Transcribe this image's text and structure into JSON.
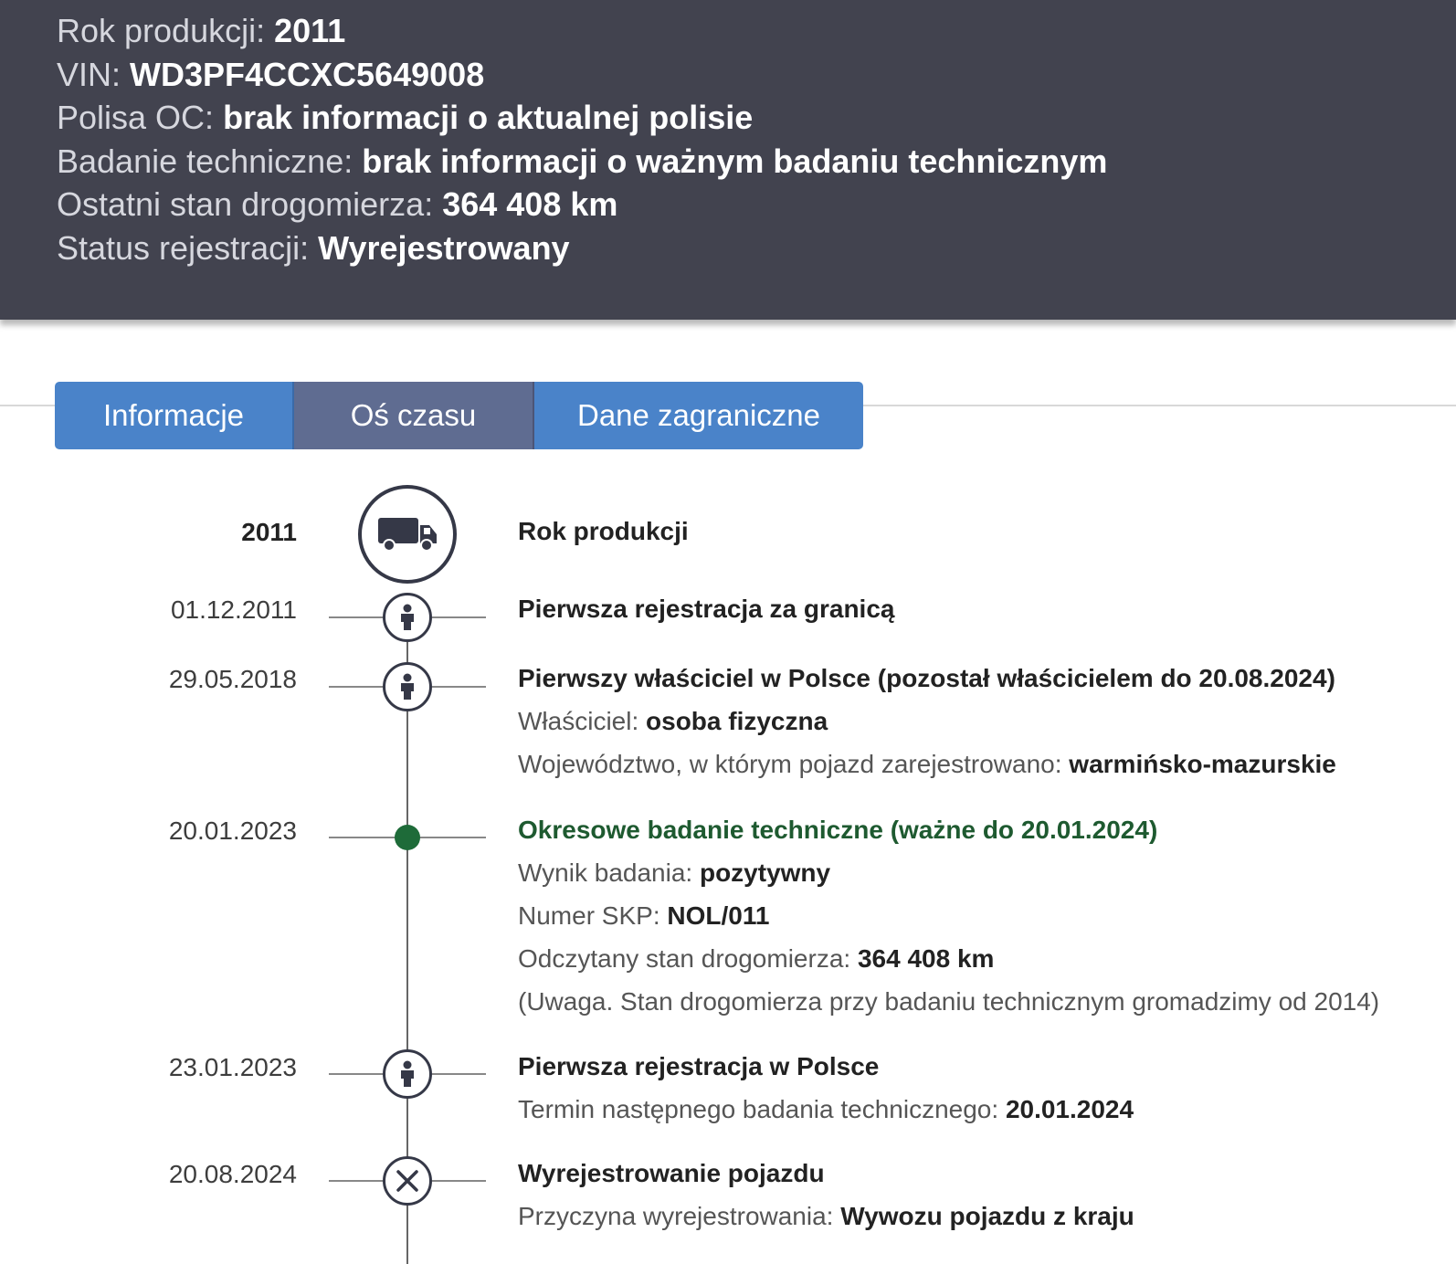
{
  "summary": {
    "rows": [
      {
        "label": "Rok produkcji:",
        "value": "2011"
      },
      {
        "label": "VIN:",
        "value": "WD3PF4CCXC5649008"
      },
      {
        "label": "Polisa OC:",
        "value": "brak informacji o aktualnej polisie"
      },
      {
        "label": "Badanie techniczne:",
        "value": "brak informacji o ważnym badaniu technicznym"
      },
      {
        "label": "Ostatni stan drogomierza:",
        "value": "364 408 km"
      },
      {
        "label": "Status rejestracji:",
        "value": "Wyrejestrowany"
      }
    ]
  },
  "tabs": [
    {
      "label": "Informacje"
    },
    {
      "label": "Oś czasu",
      "active": true
    },
    {
      "label": "Dane zagraniczne"
    }
  ],
  "timeline": [
    {
      "date": "2011",
      "icon": "truck-icon",
      "title": "Rok produkcji"
    },
    {
      "date": "01.12.2011",
      "icon": "person-icon",
      "title": "Pierwsza rejestracja za granicą"
    },
    {
      "date": "29.05.2018",
      "icon": "person-icon",
      "title": "Pierwszy właściciel w Polsce (pozostał właścicielem do 20.08.2024)",
      "details": [
        {
          "label": "Właściciel:",
          "value": "osoba fizyczna"
        },
        {
          "label": "Województwo, w którym pojazd zarejestrowano:",
          "value": "warmińsko-mazurskie"
        }
      ]
    },
    {
      "date": "20.01.2023",
      "icon": "inspection-dot",
      "title": "Okresowe badanie techniczne (ważne do 20.01.2024)",
      "title_color": "#1e5a30",
      "details": [
        {
          "label": "Wynik badania:",
          "value": "pozytywny"
        },
        {
          "label": "Numer SKP:",
          "value": "NOL/011"
        },
        {
          "label": "Odczytany stan drogomierza:",
          "value": "364 408 km"
        }
      ],
      "note": "(Uwaga. Stan drogomierza przy badaniu technicznym gromadzimy od 2014)"
    },
    {
      "date": "23.01.2023",
      "icon": "person-icon",
      "title": "Pierwsza rejestracja w Polsce",
      "details": [
        {
          "label": "Termin następnego badania technicznego:",
          "value": "20.01.2024"
        }
      ]
    },
    {
      "date": "20.08.2024",
      "icon": "x-icon",
      "title": "Wyrejestrowanie pojazdu",
      "details": [
        {
          "label": "Przyczyna wyrejestrowania:",
          "value": "Wywozu pojazdu z kraju"
        }
      ]
    }
  ]
}
